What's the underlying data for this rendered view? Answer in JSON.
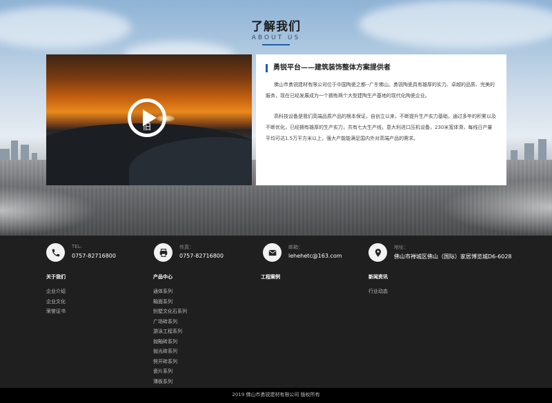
{
  "about": {
    "title": "了解我们",
    "subtitle": "ABOUT US",
    "video_caption": "旧",
    "heading": "勇锐平台——建筑装饰整体方案提供者",
    "paragraph1": "佛山市勇锐建材有限公司位于中国陶瓷之都--广东佛山。勇锐陶瓷具有雄厚的实力、卓越的品质、完美的服务，现在已经发展成为一个拥有两个大型建陶生产基地的现代化陶瓷企业。",
    "paragraph2": "高科技设备是我们高端品质产品的根本保证，自创立以来，不断提升生产实力基础，通过多年的积累以及不断优化，已经拥有雄厚的生产实力，共有七大生产线，意大利进口压机设备，230米宽体滑，每线日产量平均可达1.5万平方米以上，强大产能能满足国内外对高端产品的需求。"
  },
  "contacts": [
    {
      "icon": "phone-icon",
      "label": "TEL:",
      "value": "0757-82716800"
    },
    {
      "icon": "fax-icon",
      "label": "传真：",
      "value": "0757-82716800"
    },
    {
      "icon": "mail-icon",
      "label": "邮箱：",
      "value": "lehehetc@163.com"
    },
    {
      "icon": "location-icon",
      "label": "地址：",
      "value": "佛山市禅城区佛山（国际）家居博览城D6-6028"
    }
  ],
  "nav": {
    "about": {
      "title": "关于我们",
      "links": [
        "企业介绍",
        "企业文化",
        "荣誉证书"
      ]
    },
    "products": {
      "title": "产品中心",
      "links": [
        "通体系列",
        "釉面系列",
        "别墅文化石系列",
        "广场砖系列",
        "游泳工程系列",
        "抛釉砖系列",
        "抛光砖系列",
        "劈开砖系列",
        "瓷片系列",
        "薄板系列"
      ]
    },
    "projects": {
      "title": "工程案例",
      "links": []
    },
    "news": {
      "title": "新闻资讯",
      "links": [
        "行业动态"
      ]
    }
  },
  "copyright": "2019 佛山市勇锐建材有限公司 版权所有",
  "colors": {
    "accent": "#1f5ea6",
    "footer_bg": "#1f1f1f",
    "copyright_bg": "#000000"
  }
}
